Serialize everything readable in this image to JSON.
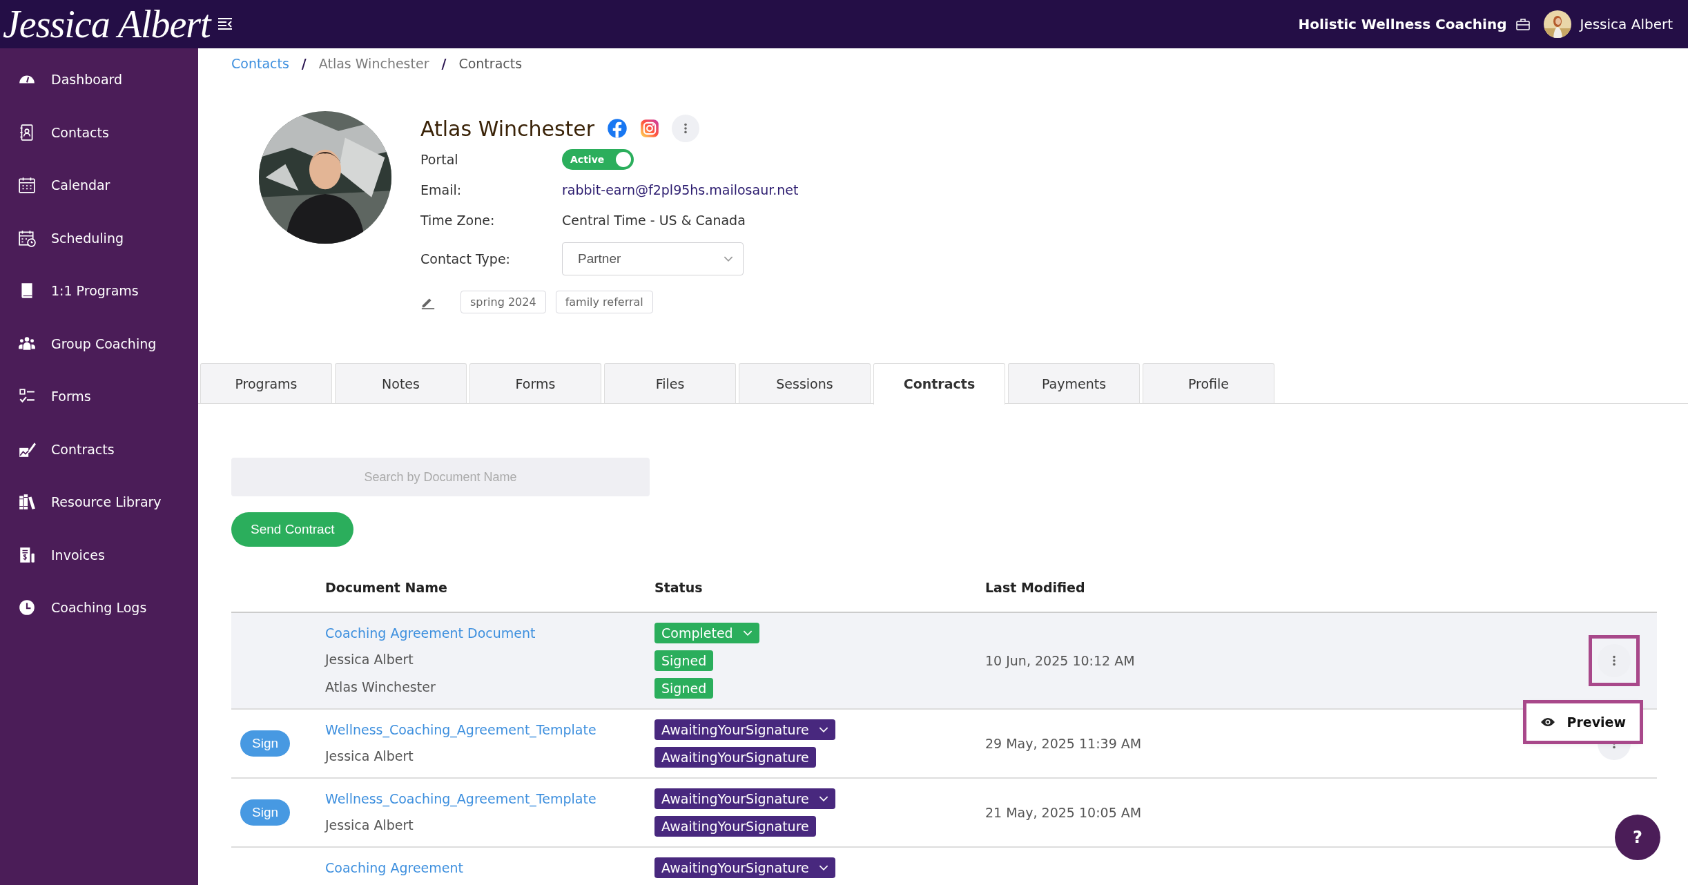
{
  "header": {
    "logo": "Jessica Albert",
    "business": "Holistic Wellness Coaching",
    "user": "Jessica Albert"
  },
  "sidebar": {
    "items": [
      {
        "label": "Dashboard",
        "kind": "gauge"
      },
      {
        "label": "Contacts",
        "kind": "contacts"
      },
      {
        "label": "Calendar",
        "kind": "calendar"
      },
      {
        "label": "Scheduling",
        "kind": "schedule"
      },
      {
        "label": "1:1 Programs",
        "kind": "book"
      },
      {
        "label": "Group Coaching",
        "kind": "group"
      },
      {
        "label": "Forms",
        "kind": "checklist"
      },
      {
        "label": "Contracts",
        "kind": "sign"
      },
      {
        "label": "Resource Library",
        "kind": "library"
      },
      {
        "label": "Invoices",
        "kind": "invoice"
      },
      {
        "label": "Coaching Logs",
        "kind": "clock"
      }
    ]
  },
  "breadcrumb": {
    "separator": "/",
    "items": [
      {
        "label": "Contacts",
        "kind": "link"
      },
      {
        "label": "Atlas Winchester",
        "kind": "text"
      },
      {
        "label": "Contracts",
        "kind": "current"
      }
    ]
  },
  "contact": {
    "name": "Atlas Winchester",
    "portal": {
      "label": "Portal",
      "badge": "Active",
      "on": true
    },
    "fields": [
      {
        "label": "Email:",
        "value": "rabbit-earn@f2pl95hs.mailosaur.net",
        "kind": "link"
      },
      {
        "label": "Time Zone:",
        "value": "Central Time - US & Canada",
        "kind": "text"
      }
    ],
    "contact_type": {
      "label": "Contact Type:",
      "value": "Partner"
    },
    "tags": [
      "spring 2024",
      "family referral"
    ]
  },
  "tabs": [
    {
      "label": "Programs",
      "selected": false
    },
    {
      "label": "Notes",
      "selected": false
    },
    {
      "label": "Forms",
      "selected": false
    },
    {
      "label": "Files",
      "selected": false
    },
    {
      "label": "Sessions",
      "selected": false
    },
    {
      "label": "Contracts",
      "selected": true
    },
    {
      "label": "Payments",
      "selected": false
    },
    {
      "label": "Profile",
      "selected": false
    }
  ],
  "search": {
    "placeholder": "Search by Document Name"
  },
  "send_button": "Send Contract",
  "table": {
    "columns": [
      "Document Name",
      "Status",
      "Last Modified"
    ],
    "rows": [
      {
        "selected": true,
        "sign": null,
        "document": "Coaching Agreement Document",
        "status": {
          "label": "Completed",
          "color": "#2bae5c"
        },
        "signers": [
          {
            "name": "Jessica Albert",
            "status": "Signed",
            "color": "#2bae5c"
          },
          {
            "name": "Atlas Winchester",
            "status": "Signed",
            "color": "#2bae5c"
          }
        ],
        "modified": "10 Jun, 2025 10:12 AM",
        "menu": true
      },
      {
        "selected": false,
        "sign": "Sign",
        "document": "Wellness_Coaching_Agreement_Template",
        "status": {
          "label": "AwaitingYourSignature",
          "color": "#48287e"
        },
        "signers": [
          {
            "name": "Jessica Albert",
            "status": "AwaitingYourSignature",
            "color": "#48287e"
          }
        ],
        "modified": "29 May, 2025 11:39 AM",
        "menu": true
      },
      {
        "selected": false,
        "sign": "Sign",
        "document": "Wellness_Coaching_Agreement_Template",
        "status": {
          "label": "AwaitingYourSignature",
          "color": "#48287e"
        },
        "signers": [
          {
            "name": "Jessica Albert",
            "status": "AwaitingYourSignature",
            "color": "#48287e"
          }
        ],
        "modified": "21 May, 2025 10:05 AM",
        "menu": false
      },
      {
        "selected": false,
        "sign": null,
        "document": "Coaching Agreement",
        "status": {
          "label": "AwaitingYourSignature",
          "color": "#48287e"
        },
        "signers": [],
        "modified": null,
        "menu": false
      }
    ]
  },
  "popup": {
    "items": [
      {
        "label": "Preview",
        "kind": "eye"
      }
    ],
    "highlighted": true
  },
  "menu_highlighted": true,
  "help": "?"
}
